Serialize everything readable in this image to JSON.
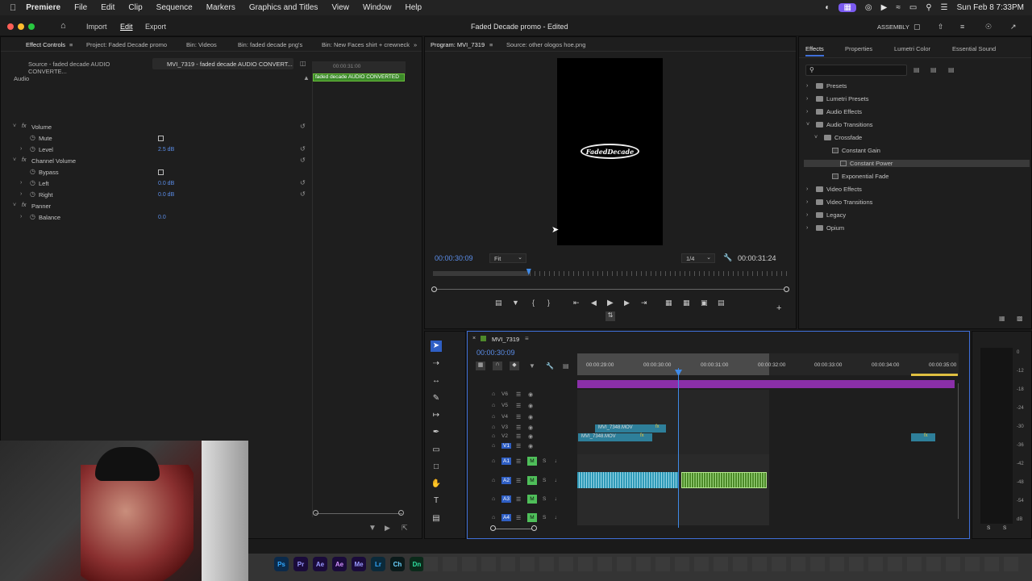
{
  "menubar": {
    "app": "Premiere",
    "items": [
      "File",
      "Edit",
      "Clip",
      "Sequence",
      "Markers",
      "Graphics and Titles",
      "View",
      "Window",
      "Help"
    ],
    "clock": "Sun Feb 8  7:33PM"
  },
  "window": {
    "title": "Faded Decade promo - Edited",
    "workspace": "ASSEMBLY",
    "nav": {
      "import": "Import",
      "edit": "Edit",
      "export": "Export"
    }
  },
  "left_tabs": [
    "Effect Controls",
    "Project: Faded Decade promo",
    "Bin: Videos",
    "Bin: faded decade png's",
    "Bin: New Faces shirt + crewneck"
  ],
  "effect_controls": {
    "source": "Source - faded decade AUDIO CONVERTE...",
    "sequence": "MVI_7319 - faded decade AUDIO CONVERT...",
    "mini_time": "00:00:31:00",
    "mini_clip": "faded decade AUDIO CONVERTED",
    "section": "Audio",
    "rows": [
      {
        "label": "Volume",
        "kind": "group"
      },
      {
        "label": "Mute",
        "kind": "check"
      },
      {
        "label": "Level",
        "kind": "value",
        "value": "2.5 dB"
      },
      {
        "label": "Channel Volume",
        "kind": "group"
      },
      {
        "label": "Bypass",
        "kind": "check"
      },
      {
        "label": "Left",
        "kind": "value",
        "value": "0.0 dB"
      },
      {
        "label": "Right",
        "kind": "value",
        "value": "0.0 dB"
      },
      {
        "label": "Panner",
        "kind": "group"
      },
      {
        "label": "Balance",
        "kind": "value",
        "value": "0.0"
      }
    ]
  },
  "program": {
    "tabs": [
      "Program: MVI_7319",
      "Source: other ologos hoe.png"
    ],
    "logo_text": "FadedDecade",
    "timecode": "00:00:30:09",
    "fit": "Fit",
    "resolution": "1/4",
    "duration": "00:00:31:24",
    "playhead_fraction": 0.27
  },
  "effects": {
    "tabs": [
      "Effects",
      "Properties",
      "Lumetri Color",
      "Essential Sound"
    ],
    "tree": [
      {
        "label": "Presets",
        "depth": 0,
        "type": "folder",
        "open": false
      },
      {
        "label": "Lumetri Presets",
        "depth": 0,
        "type": "folder",
        "open": false
      },
      {
        "label": "Audio Effects",
        "depth": 0,
        "type": "folder",
        "open": false
      },
      {
        "label": "Audio Transitions",
        "depth": 0,
        "type": "folder",
        "open": true
      },
      {
        "label": "Crossfade",
        "depth": 1,
        "type": "folder",
        "open": true
      },
      {
        "label": "Constant Gain",
        "depth": 2,
        "type": "fx"
      },
      {
        "label": "Constant Power",
        "depth": 2,
        "type": "fx",
        "selected": true
      },
      {
        "label": "Exponential Fade",
        "depth": 2,
        "type": "fx"
      },
      {
        "label": "Video Effects",
        "depth": 0,
        "type": "folder",
        "open": false
      },
      {
        "label": "Video Transitions",
        "depth": 0,
        "type": "folder",
        "open": false
      },
      {
        "label": "Legacy",
        "depth": 0,
        "type": "folder",
        "open": false
      },
      {
        "label": "Opium",
        "depth": 0,
        "type": "folder",
        "open": false
      }
    ]
  },
  "timeline": {
    "sequence": "MVI_7319",
    "timecode": "00:00:30:09",
    "ruler": [
      "00:00:29:00",
      "00:00:30:00",
      "00:00:31:00",
      "00:00:32:00",
      "00:00:33:00",
      "00:00:34:00",
      "00:00:35:00"
    ],
    "video_tracks": [
      "V6",
      "V5",
      "V4",
      "V3",
      "V2",
      "V1"
    ],
    "audio_tracks": [
      "A1",
      "A2",
      "A3",
      "A4"
    ],
    "clips": {
      "v3": "MVI_7348.MOV",
      "v2": "MVI_7348.MOV",
      "fx": "fx"
    },
    "mute": "M",
    "solo": "S"
  },
  "meter": {
    "scale": [
      "0",
      "-12",
      "-18",
      "-24",
      "-30",
      "-36",
      "-42",
      "-48",
      "-54",
      "dB"
    ],
    "bottom": [
      "S",
      "S"
    ]
  },
  "dock": [
    "Ps",
    "Pr",
    "Ae",
    "Ae",
    "Me",
    "Lr",
    "Ch",
    "Dn"
  ],
  "colors": {
    "accent": "#3f6fd8",
    "purple": "#8a2fa8",
    "audio_clip": "#2f9ab8",
    "audio_sel": "#6bbf3a",
    "video_clip": "#2e7f9a"
  }
}
